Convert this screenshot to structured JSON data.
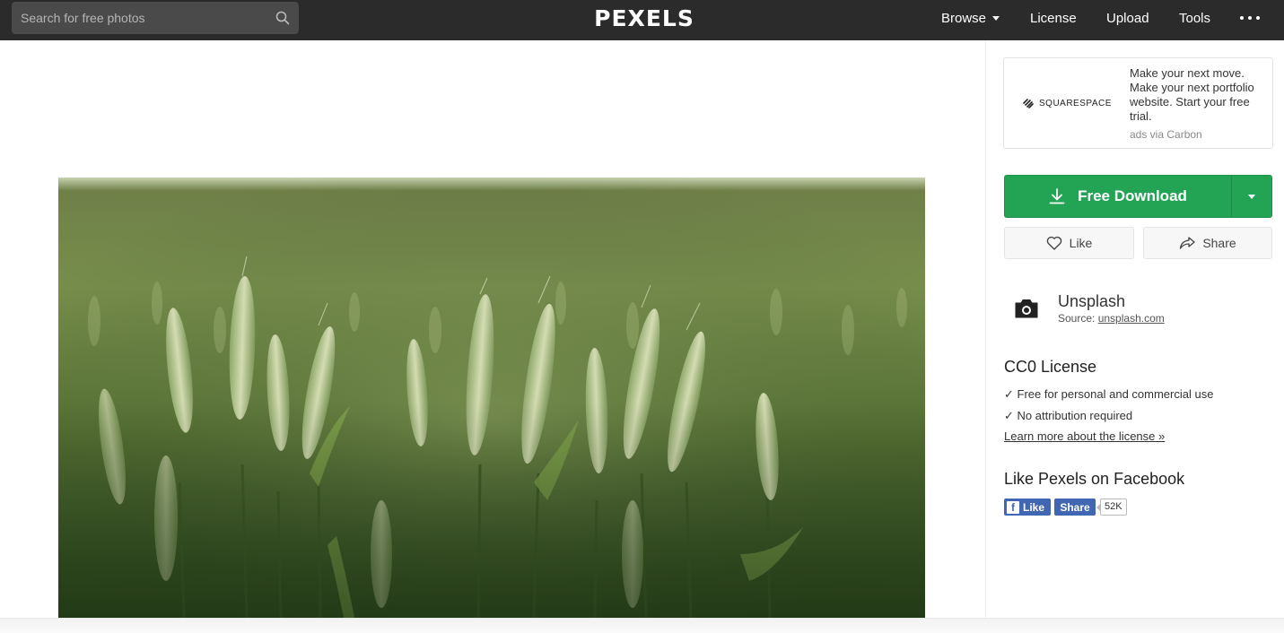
{
  "header": {
    "search_placeholder": "Search for free photos",
    "logo": "PEXELS",
    "nav": {
      "browse": "Browse",
      "license": "License",
      "upload": "Upload",
      "tools": "Tools"
    }
  },
  "ad": {
    "brand": "SQUARESPACE",
    "text": "Make your next move. Make your next portfolio website. Start your free trial.",
    "via": "ads via Carbon"
  },
  "actions": {
    "download_label": "Free Download",
    "like_label": "Like",
    "share_label": "Share"
  },
  "source": {
    "name": "Unsplash",
    "prefix": "Source:",
    "link": "unsplash.com"
  },
  "license": {
    "title": "CC0 License",
    "items": [
      "✓ Free for personal and commercial use",
      "✓ No attribution required"
    ],
    "link": "Learn more about the license »"
  },
  "facebook": {
    "title": "Like Pexels on Facebook",
    "like_label": "Like",
    "share_label": "Share",
    "count": "52K"
  },
  "colors": {
    "topbar": "#2b2b2b",
    "download_green": "#23a455",
    "facebook_blue": "#4267b2"
  },
  "icons": {
    "search": "search-icon",
    "download": "download-icon",
    "heart": "heart-icon",
    "share": "share-arrow-icon",
    "camera": "camera-icon",
    "more": "more-dots-icon"
  }
}
